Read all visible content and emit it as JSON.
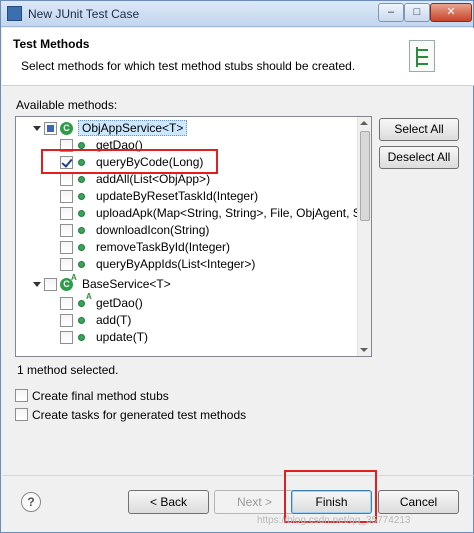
{
  "window": {
    "title": "New JUnit Test Case",
    "controls": {
      "minimize": "–",
      "maximize": "□",
      "close": "✕"
    }
  },
  "header": {
    "title": "Test Methods",
    "description": "Select methods for which test method stubs should be created."
  },
  "available_label": "Available methods:",
  "tree": {
    "items": [
      {
        "kind": "class",
        "label": "ObjAppService<T>",
        "expanded": true,
        "check": "partial",
        "selected": true
      },
      {
        "kind": "method",
        "label": "getDao()",
        "check": "none"
      },
      {
        "kind": "method",
        "label": "queryByCode(Long)",
        "check": "checked"
      },
      {
        "kind": "method",
        "label": "addAll(List<ObjApp>)",
        "check": "none"
      },
      {
        "kind": "method",
        "label": "updateByResetTaskId(Integer)",
        "check": "none"
      },
      {
        "kind": "method",
        "label": "uploadApk(Map<String, String>, File, ObjAgent, Str",
        "check": "none"
      },
      {
        "kind": "method",
        "label": "downloadIcon(String)",
        "check": "none"
      },
      {
        "kind": "method",
        "label": "removeTaskById(Integer)",
        "check": "none"
      },
      {
        "kind": "method",
        "label": "queryByAppIds(List<Integer>)",
        "check": "none"
      },
      {
        "kind": "class",
        "label": "BaseService<T>",
        "expanded": true,
        "check": "none",
        "abstract_mark": "A"
      },
      {
        "kind": "method",
        "label": "getDao()",
        "check": "none",
        "abstract_mark": "A"
      },
      {
        "kind": "method",
        "label": "add(T)",
        "check": "none"
      },
      {
        "kind": "method",
        "label": "update(T)",
        "check": "none"
      }
    ]
  },
  "side_buttons": {
    "select_all": "Select All",
    "deselect_all": "Deselect All"
  },
  "status": "1 method selected.",
  "options": {
    "final_stubs": {
      "label": "Create final method stubs",
      "checked": false
    },
    "create_tasks": {
      "label": "Create tasks for generated test methods",
      "checked": false
    }
  },
  "footer": {
    "help": "?",
    "back": "< Back",
    "next": "Next >",
    "finish": "Finish",
    "cancel": "Cancel"
  },
  "watermark": "https://blog.csdn.net/qq_35774213",
  "colors": {
    "highlight_box": "#e02020",
    "method_dot": "#3aa35b",
    "selection": "#cce8ff"
  },
  "icons": {
    "method": "public-method-icon",
    "class": "class-icon",
    "header": "test-methods-banner-icon"
  }
}
